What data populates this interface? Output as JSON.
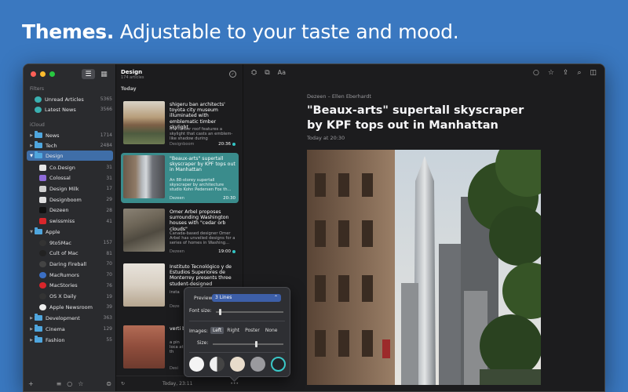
{
  "headline": {
    "bold": "Themes.",
    "rest": " Adjustable to your taste and mood."
  },
  "colors": {
    "background": "#3a78c0",
    "accent": "#3a8c8c",
    "selection": "#3f6ea8"
  },
  "sidebar": {
    "filters_label": "Filters",
    "filters": [
      {
        "label": "Unread Articles",
        "count": "5365",
        "icon": "unread-icon"
      },
      {
        "label": "Latest News",
        "count": "3566",
        "icon": "clock-icon"
      }
    ],
    "icloud_label": "iCloud",
    "folders": [
      {
        "label": "News",
        "count": "1714",
        "expanded": false
      },
      {
        "label": "Tech",
        "count": "2484",
        "expanded": false
      },
      {
        "label": "Design",
        "count": "",
        "expanded": true,
        "selected": true
      }
    ],
    "design_feeds": [
      {
        "label": "Co.Design",
        "count": "31",
        "icon": "co-icon",
        "color": "#e6e6e6"
      },
      {
        "label": "Colossal",
        "count": "31",
        "icon": "colossal-icon",
        "color": "#8e6bd8"
      },
      {
        "label": "Design Milk",
        "count": "17",
        "icon": "designmilk-icon",
        "color": "#d0d0d0"
      },
      {
        "label": "Designboom",
        "count": "29",
        "icon": "designboom-icon",
        "color": "#e0e0e0"
      },
      {
        "label": "Dezeen",
        "count": "28",
        "icon": "dezeen-icon",
        "color": "#111111"
      },
      {
        "label": "swissmiss",
        "count": "41",
        "icon": "swissmiss-icon",
        "color": "#d8262b"
      }
    ],
    "apple_folder": {
      "label": "Apple",
      "count": ""
    },
    "apple_feeds": [
      {
        "label": "9to5Mac",
        "count": "157",
        "icon": "9to5mac-icon",
        "color": "#333333"
      },
      {
        "label": "Cult of Mac",
        "count": "81",
        "icon": "cultofmac-icon",
        "color": "#222222"
      },
      {
        "label": "Daring Fireball",
        "count": "70",
        "icon": "star-icon",
        "color": "#444444"
      },
      {
        "label": "MacRumors",
        "count": "70",
        "icon": "macrumors-icon",
        "color": "#3b6fc4"
      },
      {
        "label": "MacStories",
        "count": "76",
        "icon": "macstories-icon",
        "color": "#d8262b"
      },
      {
        "label": "OS X Daily",
        "count": "19",
        "icon": "osxdaily-icon",
        "color": "#333333"
      },
      {
        "label": "Apple Newsroom",
        "count": "39",
        "icon": "apple-icon",
        "color": "#eeeeee"
      }
    ],
    "more_folders": [
      {
        "label": "Development",
        "count": "363"
      },
      {
        "label": "Cinema",
        "count": "129"
      },
      {
        "label": "Fashion",
        "count": "55"
      }
    ]
  },
  "list": {
    "title": "Design",
    "subtitle": "174 articles",
    "day": "Today",
    "articles": [
      {
        "title": "shigeru ban architects' toyota city museum illuminated with emblematic timber skylight",
        "snippet": "the timber roof features a skylight that casts an emblem-like shadow during",
        "source": "Designboom",
        "time": "20:36",
        "unread": true
      },
      {
        "title": "\"Beaux-arts\" supertall skyscraper by KPF tops out in Manhattan",
        "snippet": "An 88-storey supertall skyscraper by architecture studio Kohn Pedersen Fox th...",
        "source": "Dezeen",
        "time": "20:30",
        "unread": false
      },
      {
        "title": "Omer Arbel proposes surrounding Washington houses with \"cedar orb clouds\"",
        "snippet": "Canada-based designer Omer Arbel has unveiled designs for a series of homes in Washing...",
        "source": "Dezeen",
        "time": "19:00",
        "unread": true
      },
      {
        "title": "Instituto Tecnológico y de Estudios Superiores de Monterrey presents three student-designed",
        "snippet": "insta",
        "source": "Deze",
        "time": "",
        "unread": false
      },
      {
        "title": "verti brick",
        "snippet": "a pin loca at th",
        "source": "Desi",
        "time": "",
        "unread": false
      }
    ],
    "status": "Today, 23:11"
  },
  "reader": {
    "byline": "Dezeen – Ellen Eberhardt",
    "title": "\"Beaux-arts\" supertall skyscraper by KPF tops out in Manhattan",
    "date": "Today at 20:30",
    "text_size_label": "Aa"
  },
  "popover": {
    "preview_label": "Preview:",
    "preview_value": "3 Lines",
    "font_size_label": "Font size:",
    "font_size": 0.05,
    "images_label": "Images:",
    "image_options": [
      "Left",
      "Right",
      "Poster",
      "None"
    ],
    "image_selected": "Left",
    "size_label": "Size:",
    "image_size": 0.6,
    "themes": [
      {
        "name": "light",
        "color": "#f4f4f4"
      },
      {
        "name": "auto",
        "color": "#bdbdbd"
      },
      {
        "name": "sepia",
        "color": "#e8dccb"
      },
      {
        "name": "gray",
        "color": "#9a9a9e"
      },
      {
        "name": "dark",
        "color": "#222428",
        "selected": true
      }
    ]
  }
}
